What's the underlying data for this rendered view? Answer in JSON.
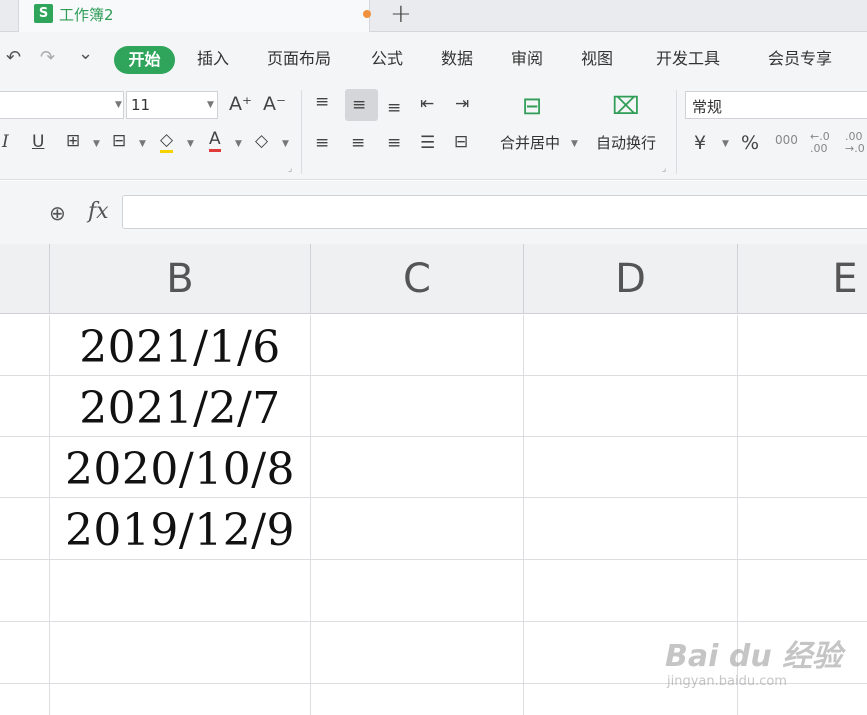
{
  "tab": {
    "logo": "S",
    "title": "工作簿2",
    "add": "+"
  },
  "quick_access": {
    "undo": "↶",
    "redo": "↷",
    "more": "⌄"
  },
  "menu": {
    "items": [
      "开始",
      "插入",
      "页面布局",
      "公式",
      "数据",
      "审阅",
      "视图",
      "开发工具",
      "会员专享"
    ]
  },
  "ribbon": {
    "font_size": "11",
    "grow_font": "A⁺",
    "shrink_font": "A⁻",
    "merge_center": "合并居中",
    "wrap_text": "自动换行",
    "number_format": "常规",
    "currency": "¥",
    "percent": "%",
    "thousands": "000",
    "inc_decimal": "←.0\n.00",
    "dec_decimal": ".00\n→.0"
  },
  "formula_bar": {
    "fx": "fx",
    "value": ""
  },
  "grid": {
    "columns": [
      "B",
      "C",
      "D",
      "E"
    ],
    "cells": [
      "2021/1/6",
      "2021/2/7",
      "2020/10/8",
      "2019/12/9"
    ]
  },
  "watermark": {
    "main": "Bai du 经验",
    "sub": "jingyan.baidu.com"
  }
}
